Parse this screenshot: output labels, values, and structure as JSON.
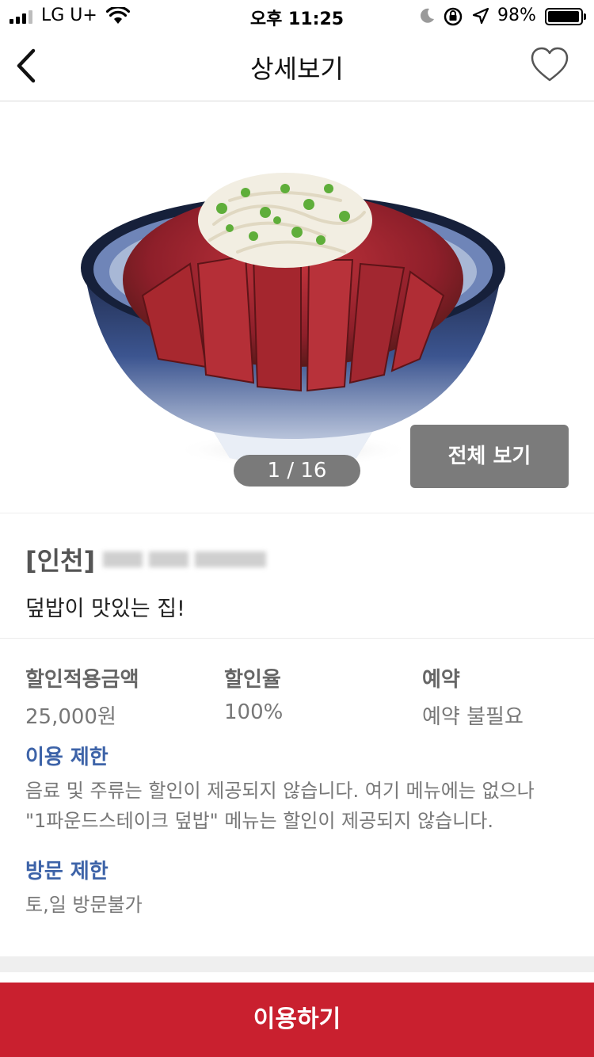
{
  "status_bar": {
    "carrier": "LG U+",
    "time": "오후 11:25",
    "battery_percent": "98%",
    "battery_level": 0.98
  },
  "nav": {
    "title": "상세보기",
    "back_icon": "chevron-left-icon",
    "favorite_icon": "heart-outline-icon"
  },
  "gallery": {
    "page_indicator": "1 / 16",
    "view_all_label": "전체 보기"
  },
  "store": {
    "region": "[인천]",
    "subtitle": "덮밥이 맛있는 집!"
  },
  "info": {
    "columns": [
      {
        "label": "할인적용금액",
        "value": "25,000원"
      },
      {
        "label": "할인율",
        "value": "100%"
      },
      {
        "label": "예약",
        "value": "예약 불필요"
      }
    ],
    "usage_limit_title": "이용 제한",
    "usage_limit_text_line1": "음료 및 주류는 할인이 제공되지 않습니다. 여기 메뉴에는 없으나",
    "usage_limit_text_line2": "\"1파운드스테이크 덮밥\" 메뉴는 할인이 제공되지 않습니다.",
    "visit_limit_title": "방문 제한",
    "visit_limit_text": "토,일 방문불가"
  },
  "footer": {
    "use_button_label": "이용하기"
  },
  "colors": {
    "accent_red": "#c9202f",
    "heading_blue": "#3d63a8",
    "gray_button": "#7b7b7b"
  }
}
